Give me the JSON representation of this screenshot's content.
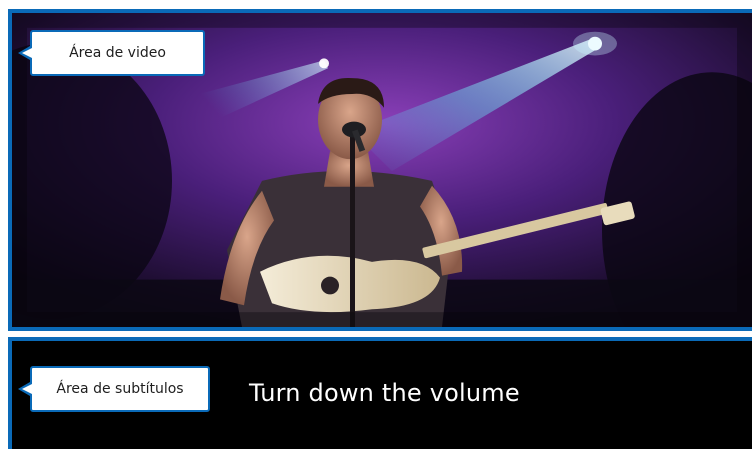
{
  "video_area": {
    "label": "Área de video",
    "scene": "concert-singer-guitar"
  },
  "subtitle_area": {
    "label": "Área de subtítulos",
    "caption": "Turn down the volume"
  },
  "colors": {
    "accent_border": "#0a6ab8",
    "subtitle_background": "#000000",
    "subtitle_text": "#ffffff",
    "callout_background": "#ffffff"
  }
}
